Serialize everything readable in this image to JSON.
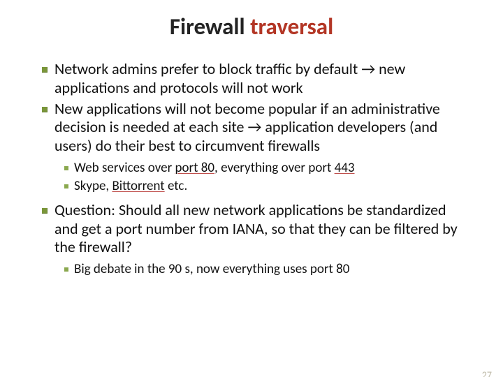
{
  "slide": {
    "title_plain_prefix": "Firewall ",
    "title_accent_word": "traversal",
    "bullets": [
      {
        "text": "Network admins prefer to block traffic by default → new applications and protocols will not work"
      },
      {
        "text": "New applications will not become popular if an administrative decision is needed at each site → application developers (and users) do their best to circumvent firewalls",
        "sub": [
          {
            "prefix": "Web services over ",
            "u1": "port 80",
            "mid": ", everything over port ",
            "u2": "443",
            "suffix": ""
          },
          {
            "prefix": "Skype, ",
            "u1": "Bittorrent",
            "mid": " etc.",
            "u2": "",
            "suffix": ""
          }
        ]
      },
      {
        "text": "Question: Should all new network applications be standardized and get a port number from IANA, so that they can be filtered by the firewall?",
        "sub": [
          {
            "prefix": "Big debate in the 90 s, now everything uses port 80",
            "u1": "",
            "mid": "",
            "u2": "",
            "suffix": ""
          }
        ]
      }
    ],
    "page_number": "27"
  }
}
